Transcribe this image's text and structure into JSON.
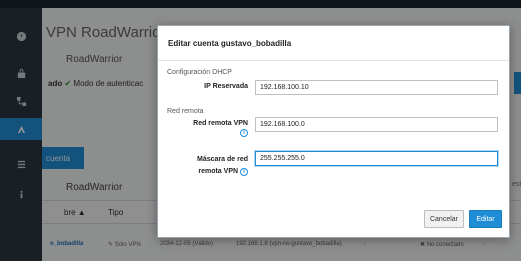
{
  "page": {
    "title": "VPN RoadWarrior",
    "subtitle": "RoadWarrior",
    "status_prefix": "ado",
    "status_check": "✔",
    "status_text": "Modo de autenticac",
    "tab_label": "cuenta",
    "section_title": "RoadWarrior",
    "right_label": "est"
  },
  "sidebar": {
    "icons": [
      "gauge-icon",
      "lock-icon",
      "network-icon",
      "vpn-icon",
      "list-icon",
      "info-icon"
    ]
  },
  "table": {
    "headers": {
      "name": "bre ▲",
      "type": "Tipo"
    },
    "row": {
      "user": "o_bobadilla",
      "type": "Sólo VPN",
      "expiry": "2034-12-05 (Válido)",
      "ip": "192.168.1.8 (vpn-rw-gustavo_bobadilla)",
      "dash1": "-",
      "status": "✖ No conectado",
      "dash2": "-"
    }
  },
  "modal": {
    "title": "Editar cuenta gustavo_bobadilla",
    "dhcp_section": "Configuración DHCP",
    "ip_label": "IP Reservada",
    "ip_value": "192.168.100.10",
    "remote_section": "Red remota",
    "remote_net_label": "Red remota VPN",
    "remote_net_value": "192.168.100.0",
    "mask_label_1": "Máscara de red",
    "mask_label_2": "remota VPN",
    "mask_value": "255.255.255.0",
    "info_glyph": "i",
    "cancel_label": "Cancelar",
    "edit_label": "Editar"
  }
}
